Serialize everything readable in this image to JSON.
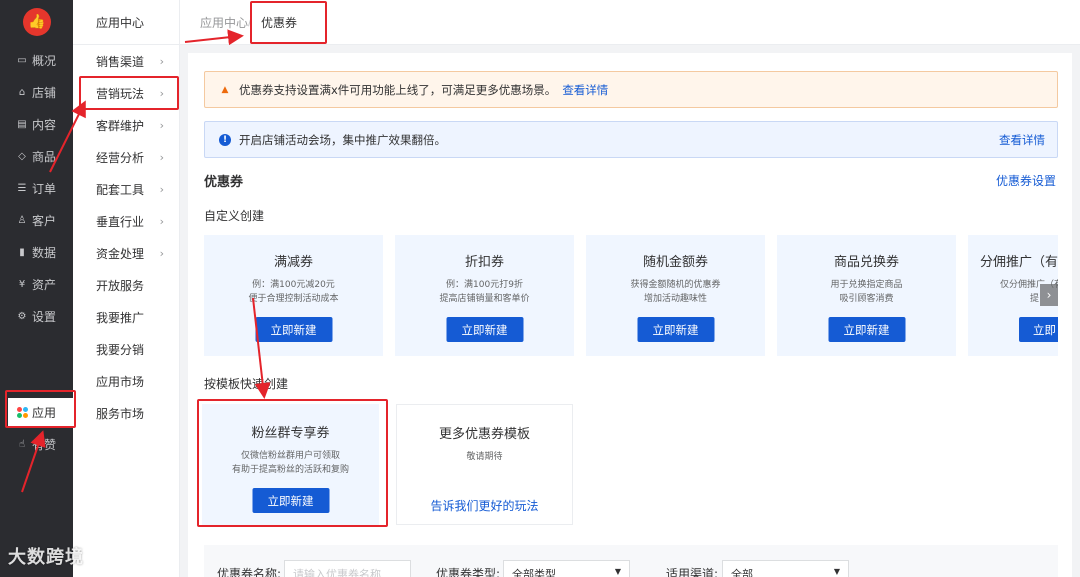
{
  "nav": {
    "items": [
      {
        "label": "概况",
        "icon": "monitor-icon"
      },
      {
        "label": "店铺",
        "icon": "store-icon"
      },
      {
        "label": "内容",
        "icon": "document-icon"
      },
      {
        "label": "商品",
        "icon": "tag-icon"
      },
      {
        "label": "订单",
        "icon": "list-icon"
      },
      {
        "label": "客户",
        "icon": "user-icon"
      },
      {
        "label": "数据",
        "icon": "bar-chart-icon"
      },
      {
        "label": "资产",
        "icon": "yen-icon"
      },
      {
        "label": "设置",
        "icon": "gear-icon"
      }
    ],
    "app": {
      "label": "应用",
      "icon": "apps-icon"
    },
    "praise": {
      "label": "有赞",
      "icon": "thumb-icon"
    }
  },
  "sidebar": {
    "title": "应用中心",
    "items": [
      {
        "label": "销售渠道",
        "chevron": true
      },
      {
        "label": "营销玩法",
        "chevron": true
      },
      {
        "label": "客群维护",
        "chevron": true
      },
      {
        "label": "经营分析",
        "chevron": true
      },
      {
        "label": "配套工具",
        "chevron": true
      },
      {
        "label": "垂直行业",
        "chevron": true
      },
      {
        "label": "资金处理",
        "chevron": true
      },
      {
        "label": "开放服务",
        "chevron": false
      },
      {
        "label": "我要推广",
        "chevron": false
      },
      {
        "label": "我要分销",
        "chevron": false
      },
      {
        "label": "应用市场",
        "chevron": false
      },
      {
        "label": "服务市场",
        "chevron": false
      }
    ]
  },
  "breadcrumb": {
    "parent": "应用中心",
    "separator": "/",
    "current": "优惠券"
  },
  "notices": {
    "warning": {
      "text": "优惠券支持设置满x件可用功能上线了，可满足更多优惠场景。",
      "link": "查看详情"
    },
    "info": {
      "text": "开启店铺活动会场，集中推广效果翻倍。",
      "link": "查看详情"
    }
  },
  "section": {
    "title": "优惠券",
    "settings_link": "优惠券设置",
    "custom_label": "自定义创建",
    "template_label": "按模板快速创建"
  },
  "cards": [
    {
      "title": "满减券",
      "desc1": "例：满100元减20元",
      "desc2": "便于合理控制活动成本",
      "button": "立即新建"
    },
    {
      "title": "折扣券",
      "desc1": "例：满100元打9折",
      "desc2": "提高店铺销量和客单价",
      "button": "立即新建"
    },
    {
      "title": "随机金额券",
      "desc1": "获得金额随机的优惠券",
      "desc2": "增加活动趣味性",
      "button": "立即新建"
    },
    {
      "title": "商品兑换券",
      "desc1": "用于兑换指定商品",
      "desc2": "吸引顾客消费",
      "button": "立即新建"
    },
    {
      "title": "分佣推广（有",
      "desc1": "仅分佣推广（有",
      "desc2": "提",
      "button": "立即"
    }
  ],
  "templates": {
    "fans": {
      "title": "粉丝群专享券",
      "desc1": "仅微信粉丝群用户可领取",
      "desc2": "有助于提高粉丝的活跃和复购",
      "button": "立即新建"
    },
    "more": {
      "title": "更多优惠券模板",
      "desc1": "敬请期待",
      "link": "告诉我们更好的玩法"
    }
  },
  "filters": {
    "name_label": "优惠券名称:",
    "name_placeholder": "请输入优惠券名称",
    "type_label": "优惠券类型:",
    "type_value": "全部类型",
    "channel_label": "适用渠道:",
    "channel_value": "全部"
  },
  "watermark": "大数跨境",
  "colors": {
    "accent": "#155bd4",
    "highlight": "#e4242b",
    "nav_bg": "#2b2c30",
    "card_bg": "#f0f6ff"
  }
}
